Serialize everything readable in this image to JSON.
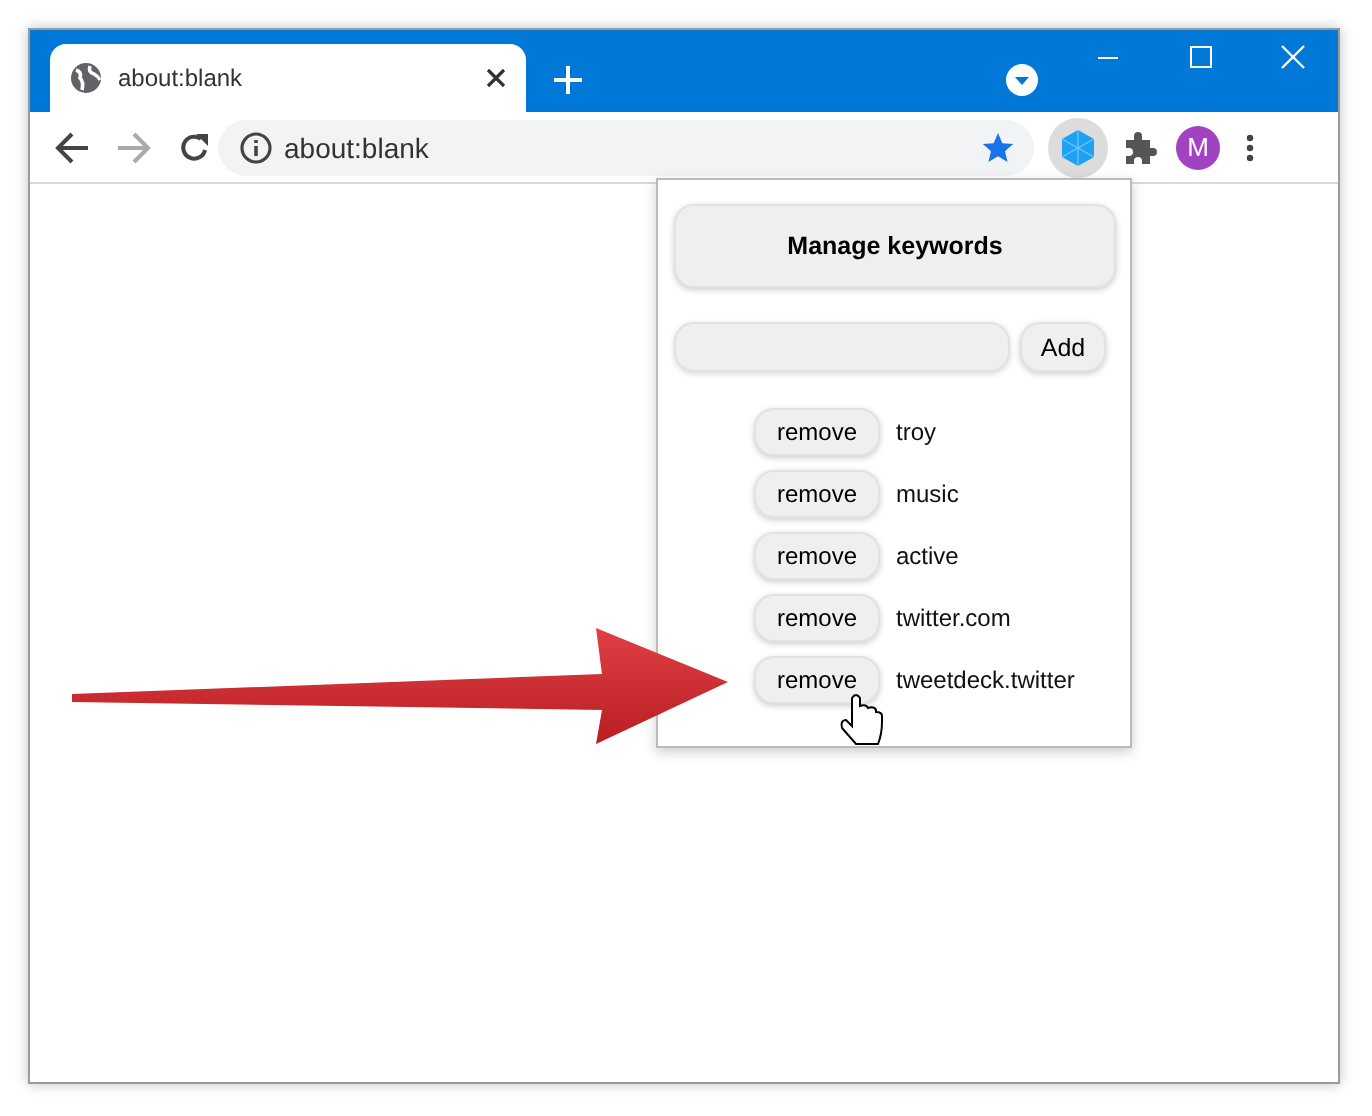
{
  "tab": {
    "title": "about:blank"
  },
  "address_bar": {
    "url": "about:blank"
  },
  "profile": {
    "initial": "M"
  },
  "popup": {
    "heading": "Manage keywords",
    "add_button": "Add",
    "keywords": [
      {
        "remove_label": "remove",
        "keyword": "troy"
      },
      {
        "remove_label": "remove",
        "keyword": "music"
      },
      {
        "remove_label": "remove",
        "keyword": "active"
      },
      {
        "remove_label": "remove",
        "keyword": "twitter.com"
      },
      {
        "remove_label": "remove",
        "keyword": "tweetdeck.twitter"
      }
    ]
  }
}
